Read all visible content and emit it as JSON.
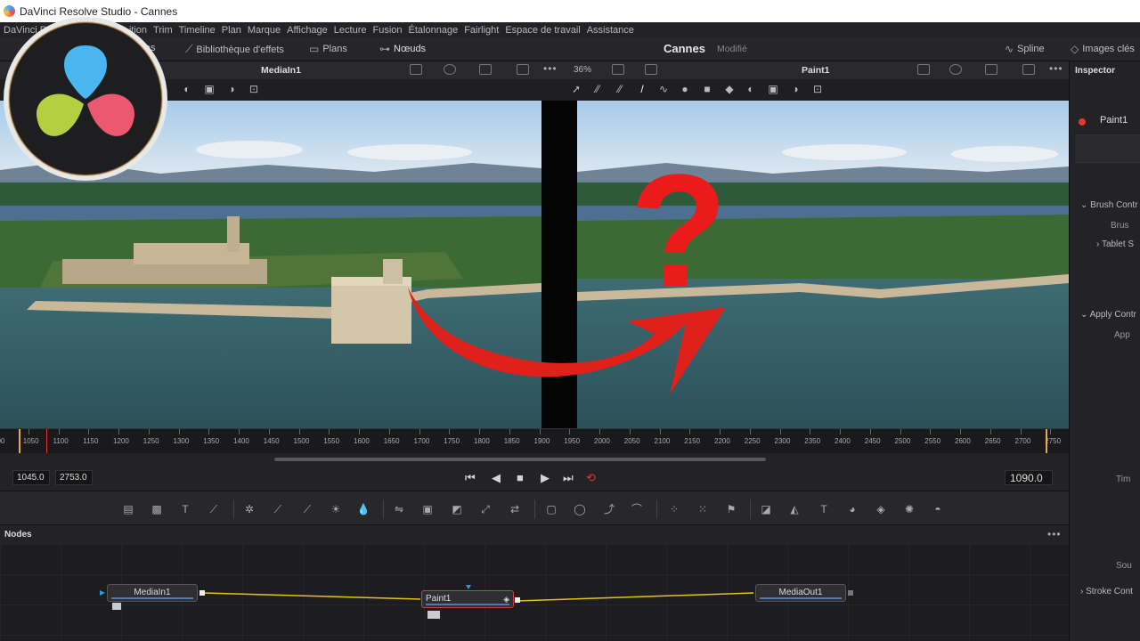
{
  "window": {
    "title": "DaVinci Resolve Studio - Cannes"
  },
  "menu": [
    "DaVinci R",
    "n",
    "ition",
    "Trim",
    "Timeline",
    "Plan",
    "Marque",
    "Affichage",
    "Lecture",
    "Fusion",
    "Étalonnage",
    "Fairlight",
    "Espace de travail",
    "Assistance"
  ],
  "toolbar": {
    "media": "lias",
    "effects": "Bibliothèque d'effets",
    "clips": "Plans",
    "nodes": "Nœuds",
    "project_name": "Cannes",
    "project_status": "Modifié",
    "spline": "Spline",
    "keyframes": "Images clés"
  },
  "viewer_left": {
    "name": "MediaIn1"
  },
  "viewer_right": {
    "name": "Paint1",
    "zoom": "36%"
  },
  "timeruler": {
    "ticks": [
      "000",
      "1050",
      "1100",
      "1150",
      "1200",
      "1250",
      "1300",
      "1350",
      "1400",
      "1450",
      "1500",
      "1550",
      "1600",
      "1650",
      "1700",
      "1750",
      "1800",
      "1850",
      "1900",
      "1950",
      "2000",
      "2050",
      "2100",
      "2150",
      "2200",
      "2250",
      "2300",
      "2350",
      "2400",
      "2450",
      "2500",
      "2550",
      "2600",
      "2650",
      "2700",
      "2750"
    ]
  },
  "transport": {
    "start": "1045.0",
    "end": "2753.0",
    "current": "1090.0"
  },
  "nodes_panel": {
    "title": "Nodes",
    "nodes": [
      "MediaIn1",
      "Paint1",
      "MediaOut1"
    ]
  },
  "inspector": {
    "title": "Inspector",
    "tool_name": "Paint1",
    "sections": [
      "Brush Contr",
      "Brus",
      "Tablet S",
      "Apply Contr",
      "App",
      "Tim",
      "Sou",
      "Stroke Cont"
    ]
  },
  "overlay": {
    "question_mark": "?"
  },
  "colors": {
    "accent_red": "#e0201a",
    "node_link": "#e6c21a",
    "selected_node": "#d9364a"
  }
}
